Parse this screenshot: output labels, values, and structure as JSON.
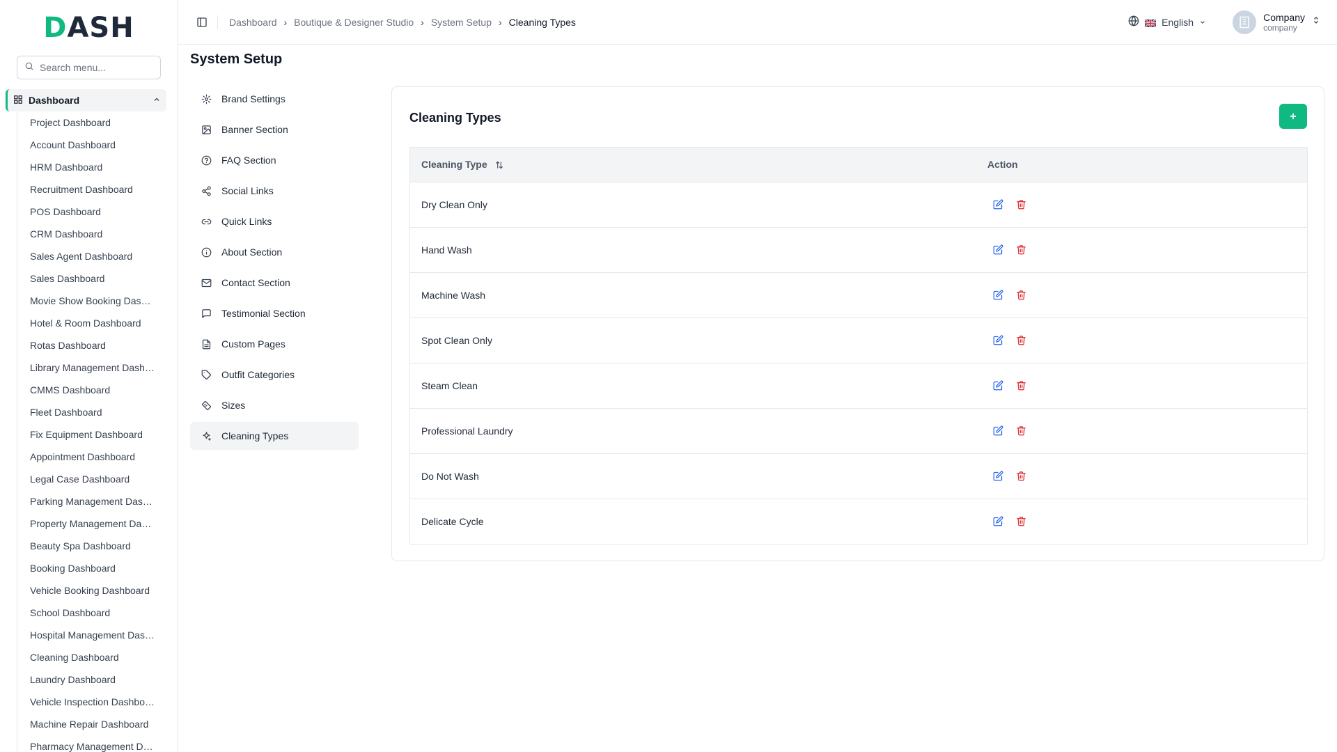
{
  "brand": {
    "logo_first": "D",
    "logo_rest": "ASH"
  },
  "sidebar": {
    "search_placeholder": "Search menu...",
    "group_label": "Dashboard",
    "items": [
      "Project Dashboard",
      "Account Dashboard",
      "HRM Dashboard",
      "Recruitment Dashboard",
      "POS Dashboard",
      "CRM Dashboard",
      "Sales Agent Dashboard",
      "Sales Dashboard",
      "Movie Show Booking Dashboard",
      "Hotel & Room Dashboard",
      "Rotas Dashboard",
      "Library Management Dashboard",
      "CMMS Dashboard",
      "Fleet Dashboard",
      "Fix Equipment Dashboard",
      "Appointment Dashboard",
      "Legal Case Dashboard",
      "Parking Management Dashboard",
      "Property Management Dashboard",
      "Beauty Spa Dashboard",
      "Booking Dashboard",
      "Vehicle Booking Dashboard",
      "School Dashboard",
      "Hospital Management Dashboard",
      "Cleaning Dashboard",
      "Laundry Dashboard",
      "Vehicle Inspection Dashboard",
      "Machine Repair Dashboard",
      "Pharmacy Management Dashboard"
    ]
  },
  "header": {
    "breadcrumb": [
      "Dashboard",
      "Boutique & Designer Studio",
      "System Setup"
    ],
    "breadcrumb_current": "Cleaning Types",
    "language": "English",
    "user_name": "Company",
    "user_role": "company"
  },
  "page": {
    "title": "System Setup"
  },
  "settings_nav": [
    {
      "label": "Brand Settings",
      "icon": "gear-icon"
    },
    {
      "label": "Banner Section",
      "icon": "image-icon"
    },
    {
      "label": "FAQ Section",
      "icon": "help-circle-icon"
    },
    {
      "label": "Social Links",
      "icon": "share-icon"
    },
    {
      "label": "Quick Links",
      "icon": "link-icon"
    },
    {
      "label": "About Section",
      "icon": "info-icon"
    },
    {
      "label": "Contact Section",
      "icon": "mail-icon"
    },
    {
      "label": "Testimonial Section",
      "icon": "message-square-icon"
    },
    {
      "label": "Custom Pages",
      "icon": "file-text-icon"
    },
    {
      "label": "Outfit Categories",
      "icon": "tag-icon"
    },
    {
      "label": "Sizes",
      "icon": "ruler-icon"
    },
    {
      "label": "Cleaning Types",
      "icon": "sparkles-icon",
      "active": true
    }
  ],
  "card": {
    "title": "Cleaning Types",
    "columns": {
      "type": "Cleaning Type",
      "action": "Action"
    },
    "rows": [
      "Dry Clean Only",
      "Hand Wash",
      "Machine Wash",
      "Spot Clean Only",
      "Steam Clean",
      "Professional Laundry",
      "Do Not Wash",
      "Delicate Cycle"
    ]
  },
  "colors": {
    "accent": "#10b981",
    "edit": "#2563eb",
    "delete": "#dc2626"
  }
}
